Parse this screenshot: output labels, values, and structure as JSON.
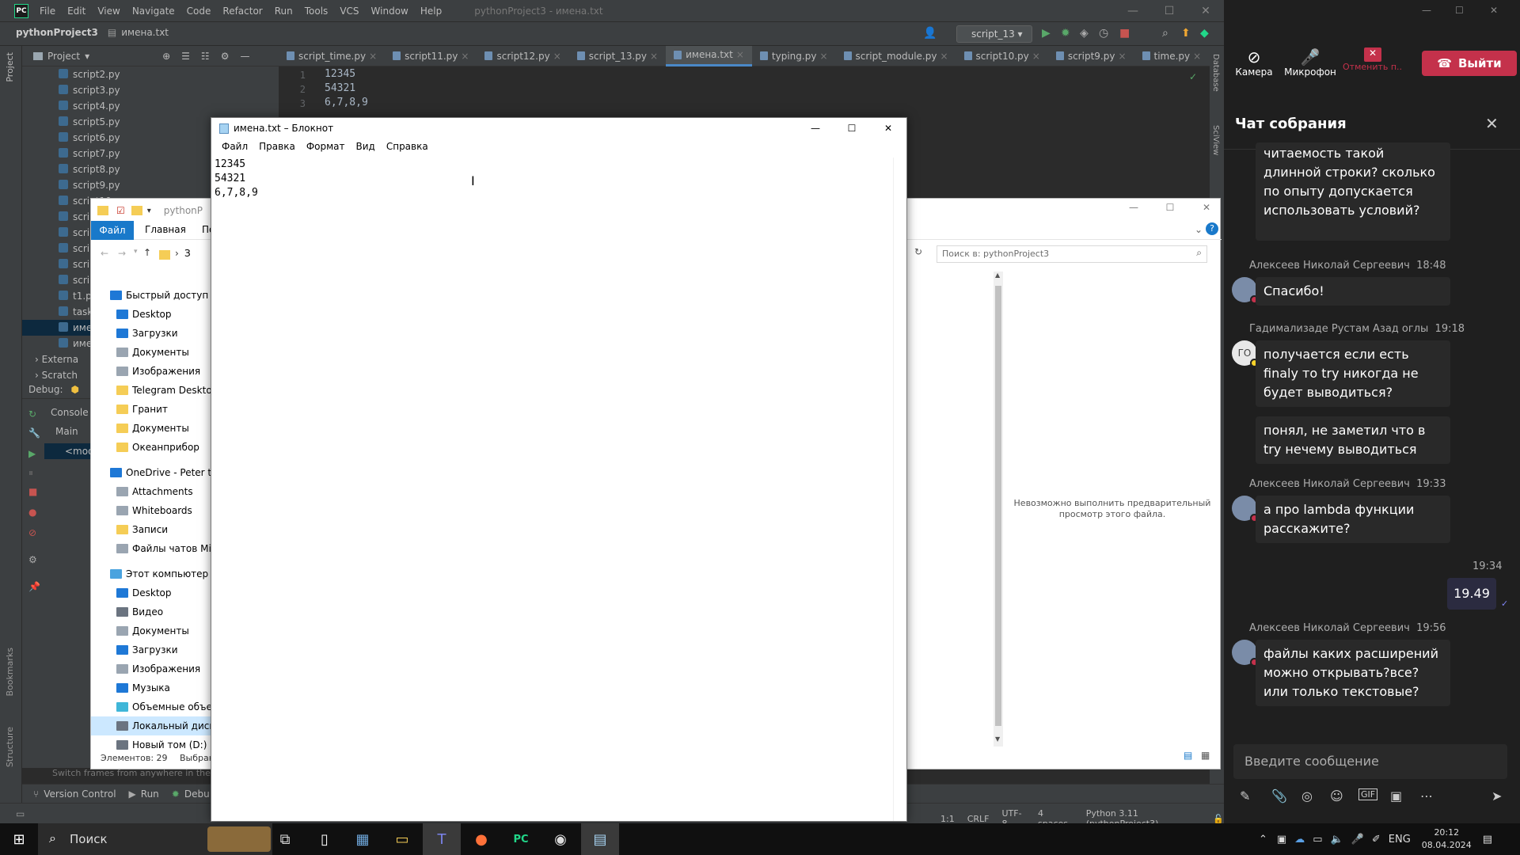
{
  "ide": {
    "menu": [
      "File",
      "Edit",
      "View",
      "Navigate",
      "Code",
      "Refactor",
      "Run",
      "Tools",
      "VCS",
      "Window",
      "Help"
    ],
    "title": "pythonProject3 - имена.txt",
    "breadcrumb": {
      "project": "pythonProject3",
      "file": "имена.txt"
    },
    "run_config": "script_13",
    "project_label": "Project",
    "tree": [
      "script2.py",
      "script3.py",
      "script4.py",
      "script5.py",
      "script6.py",
      "script7.py",
      "script8.py",
      "script9.py",
      "script10.py",
      "scrip",
      "scrip",
      "scrip",
      "scrip",
      "scrip",
      "t1.py",
      "task",
      "име",
      "име"
    ],
    "tree_extra": [
      "Externa",
      "Scratch"
    ],
    "tabs": [
      "script_time.py",
      "script11.py",
      "script12.py",
      "script_13.py",
      "имена.txt",
      "typing.py",
      "script_module.py",
      "script10.py",
      "script9.py",
      "time.py"
    ],
    "active_tab": "имена.txt",
    "editor_lines": [
      {
        "n": "1",
        "t": "12345"
      },
      {
        "n": "2",
        "t": "54321"
      },
      {
        "n": "3",
        "t": "6,7,8,9"
      }
    ],
    "debug": {
      "label": "Debug:",
      "console": "Console",
      "main": "Main",
      "mod": "<mod"
    },
    "bottom": {
      "hint": "Switch frames from anywhere in the ID",
      "vc": "Version Control",
      "run": "Run",
      "debug": "Debu"
    },
    "status": {
      "pos": "1:1",
      "eol": "CRLF",
      "enc": "UTF-8",
      "indent": "4 spaces",
      "interp": "Python 3.11 (pythonProject3)"
    },
    "right_labels": [
      "Database",
      "SciView"
    ],
    "left_labels": [
      "Project",
      "Bookmarks",
      "Structure"
    ]
  },
  "explorer": {
    "path_frag": "pythonP",
    "ribbon": [
      "Файл",
      "Главная",
      "По"
    ],
    "crumb": "З",
    "search_placeholder": "Поиск в: pythonProject3",
    "nav": [
      {
        "label": "Быстрый доступ",
        "root": true,
        "color": "#1e78d6"
      },
      {
        "label": "Desktop",
        "color": "#1e78d6"
      },
      {
        "label": "Загрузки",
        "color": "#1e78d6"
      },
      {
        "label": "Документы",
        "color": "#9aa5b1"
      },
      {
        "label": "Изображения",
        "color": "#9aa5b1"
      },
      {
        "label": "Telegram Desktop",
        "color": "#f5cd56"
      },
      {
        "label": "Гранит",
        "color": "#f5cd56"
      },
      {
        "label": "Документы",
        "color": "#f5cd56"
      },
      {
        "label": "Океанприбор",
        "color": "#f5cd56"
      },
      {
        "label": "OneDrive - Peter the",
        "root": true,
        "color": "#1e78d6"
      },
      {
        "label": "Attachments",
        "color": "#9aa5b1"
      },
      {
        "label": "Whiteboards",
        "color": "#9aa5b1"
      },
      {
        "label": "Записи",
        "color": "#f5cd56"
      },
      {
        "label": "Файлы чатов Micr",
        "color": "#9aa5b1"
      },
      {
        "label": "Этот компьютер",
        "root": true,
        "color": "#4aa3df"
      },
      {
        "label": "Desktop",
        "color": "#1e78d6"
      },
      {
        "label": "Видео",
        "color": "#6b7480"
      },
      {
        "label": "Документы",
        "color": "#9aa5b1"
      },
      {
        "label": "Загрузки",
        "color": "#1e78d6"
      },
      {
        "label": "Изображения",
        "color": "#9aa5b1"
      },
      {
        "label": "Музыка",
        "color": "#1e78d6"
      },
      {
        "label": "Объемные объект",
        "color": "#3fb6d8"
      },
      {
        "label": "Локальный диск (",
        "color": "#6b7480"
      },
      {
        "label": "Новый том (D:)",
        "color": "#6b7480"
      }
    ],
    "status": "Элементов: 29",
    "status2": "Выбран",
    "preview_msg": "Невозможно выполнить предварительный просмотр этого файла."
  },
  "notepad": {
    "title": "имена.txt – Блокнот",
    "menu": [
      "Файл",
      "Правка",
      "Формат",
      "Вид",
      "Справка"
    ],
    "lines": [
      "12345",
      "54321",
      "6,7,8,9"
    ]
  },
  "taskbar": {
    "search": "Поиск",
    "lang": "ENG",
    "time": "20:12",
    "date": "08.04.2024"
  },
  "teams": {
    "camera": "Камера",
    "mic": "Микрофон",
    "share": "Отменить п...",
    "leave": "Выйти",
    "chat_title": "Чат собрания",
    "messages": [
      {
        "text": "читаемость такой длинной строки? сколько по опыту допускается использовать условий?"
      },
      {
        "sender": "Алексеев Николай Сергеевич",
        "time": "18:48",
        "text": "Спасибо!"
      },
      {
        "sender": "Гадимализаде Рустам Азад оглы",
        "time": "19:18",
        "initials": "ГО",
        "text": "получается если есть finaly то try никогда не будет выводиться?"
      },
      {
        "text": "понял, не заметил что в try нечему выводиться"
      },
      {
        "sender": "Алексеев Николай Сергеевич",
        "time": "19:33",
        "text": "а про lambda функции расскажите?"
      },
      {
        "time": "19:34",
        "text": "19.49",
        "own": true
      },
      {
        "sender": "Алексеев Николай Сергеевич",
        "time": "19:56",
        "text": "файлы каких расширений можно открывать?все? или только текстовые?"
      }
    ],
    "input_placeholder": "Введите сообщение"
  }
}
